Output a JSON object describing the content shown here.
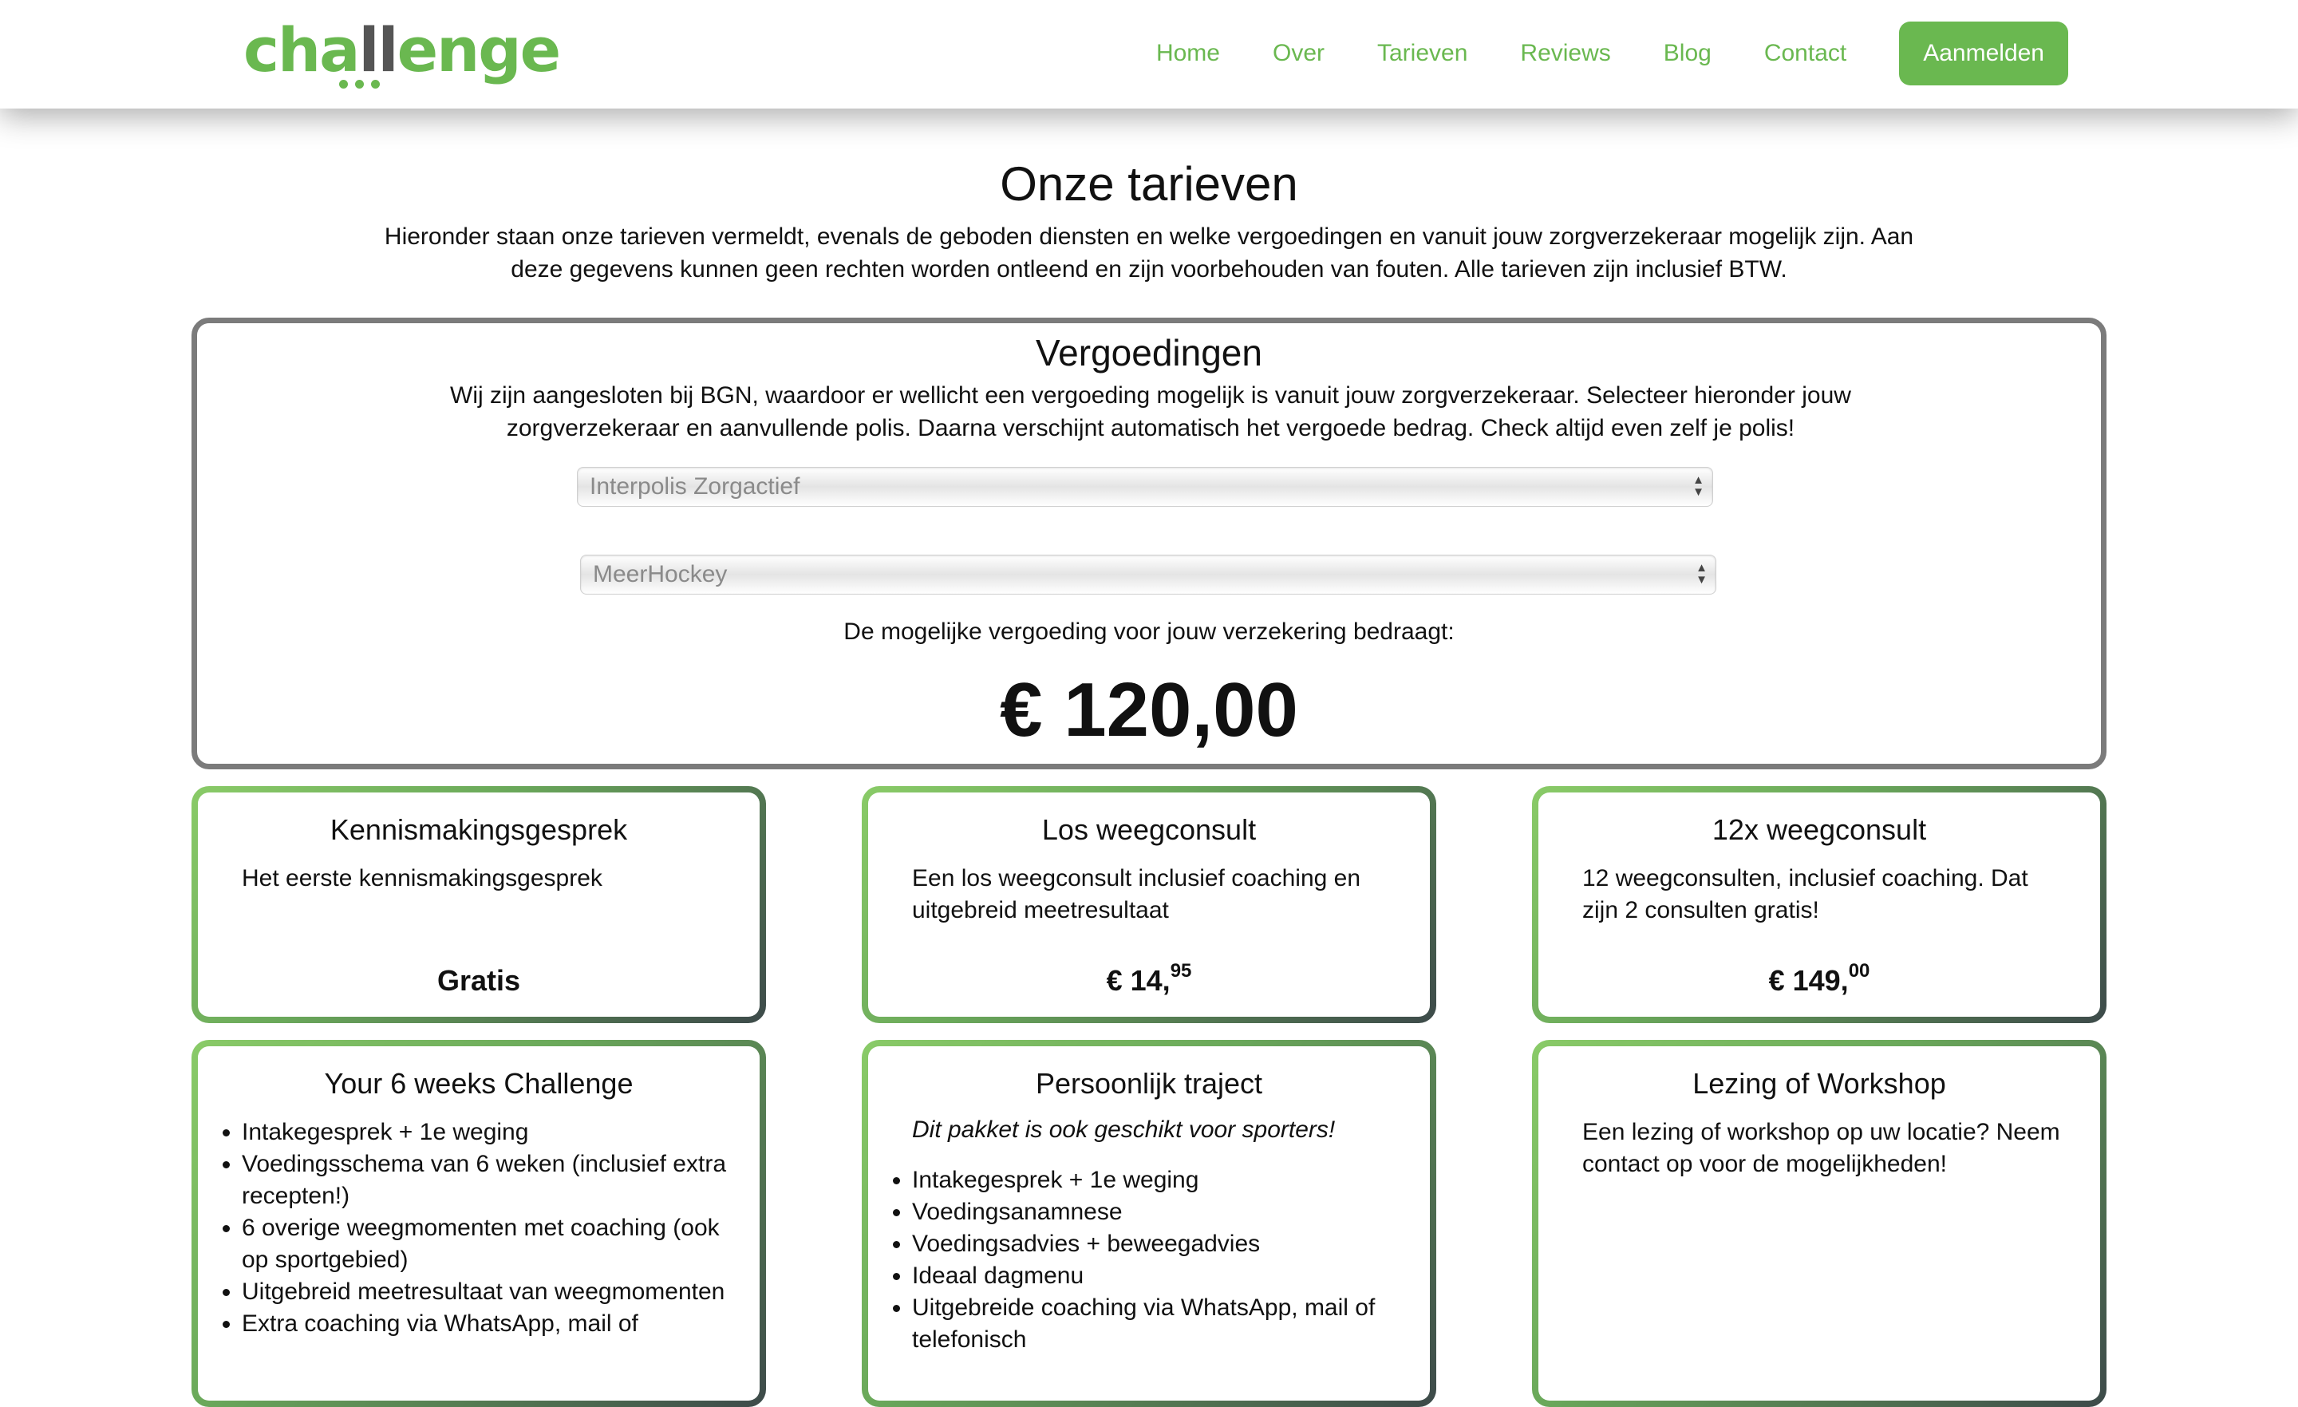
{
  "header": {
    "logo_text_green": "cha",
    "logo_text_dark": "ll",
    "logo_text_green2": "enge",
    "nav": [
      "Home",
      "Over",
      "Tarieven",
      "Reviews",
      "Blog",
      "Contact"
    ],
    "cta_label": "Aanmelden",
    "accent_color": "#6ab850"
  },
  "intro": {
    "title": "Onze tarieven",
    "text": "Hieronder staan onze tarieven vermeldt, evenals de geboden diensten en welke vergoedingen en vanuit jouw zorgverzekeraar mogelijk zijn. Aan deze gegevens kunnen geen rechten worden ontleend en zijn voorbehouden van fouten. Alle tarieven zijn inclusief BTW."
  },
  "vergoedingen": {
    "title": "Vergoedingen",
    "text": "Wij zijn aangesloten bij BGN, waardoor er wellicht een vergoeding mogelijk is vanuit jouw zorgverzekeraar. Selecteer hieronder jouw zorgverzekeraar en aanvullende polis. Daarna verschijnt automatisch het vergoede bedrag. Check altijd even zelf je polis!",
    "insurer_select": "Interpolis Zorgactief",
    "policy_select": "MeerHockey",
    "amount_label": "De mogelijke vergoeding voor jouw verzekering bedraagt:",
    "amount": "€ 120,00"
  },
  "cards": {
    "c1": {
      "title": "Kennismakingsgesprek",
      "desc": "Het eerste kennismakingsgesprek",
      "price": "Gratis"
    },
    "c2": {
      "title": "Los weegconsult",
      "desc": "Een los weegconsult inclusief coaching en uitgebreid meetresultaat",
      "price": "€ 14,",
      "cents": "95"
    },
    "c3": {
      "title": "12x weegconsult",
      "desc": "12 weegconsulten, inclusief coaching. Dat zijn 2 consulten gratis!",
      "price": "€ 149,",
      "cents": "00"
    },
    "c4": {
      "title": "Your 6 weeks Challenge",
      "items": [
        "Intakegesprek + 1e weging",
        "Voedingsschema van 6 weken (inclusief extra recepten!)",
        "6 overige weegmomenten met coaching (ook op sportgebied)",
        "Uitgebreid meetresultaat van weegmomenten",
        "Extra coaching via WhatsApp, mail of"
      ]
    },
    "c5": {
      "title": "Persoonlijk traject",
      "subtitle": "Dit pakket is ook geschikt voor sporters!",
      "items": [
        "Intakegesprek + 1e weging",
        "Voedingsanamnese",
        "Voedingsadvies + beweegadvies",
        "Ideaal dagmenu",
        "Uitgebreide coaching via WhatsApp, mail of telefonisch"
      ]
    },
    "c6": {
      "title": "Lezing of Workshop",
      "desc": "Een lezing of workshop op uw locatie? Neem contact op voor de mogelijkheden!"
    }
  }
}
